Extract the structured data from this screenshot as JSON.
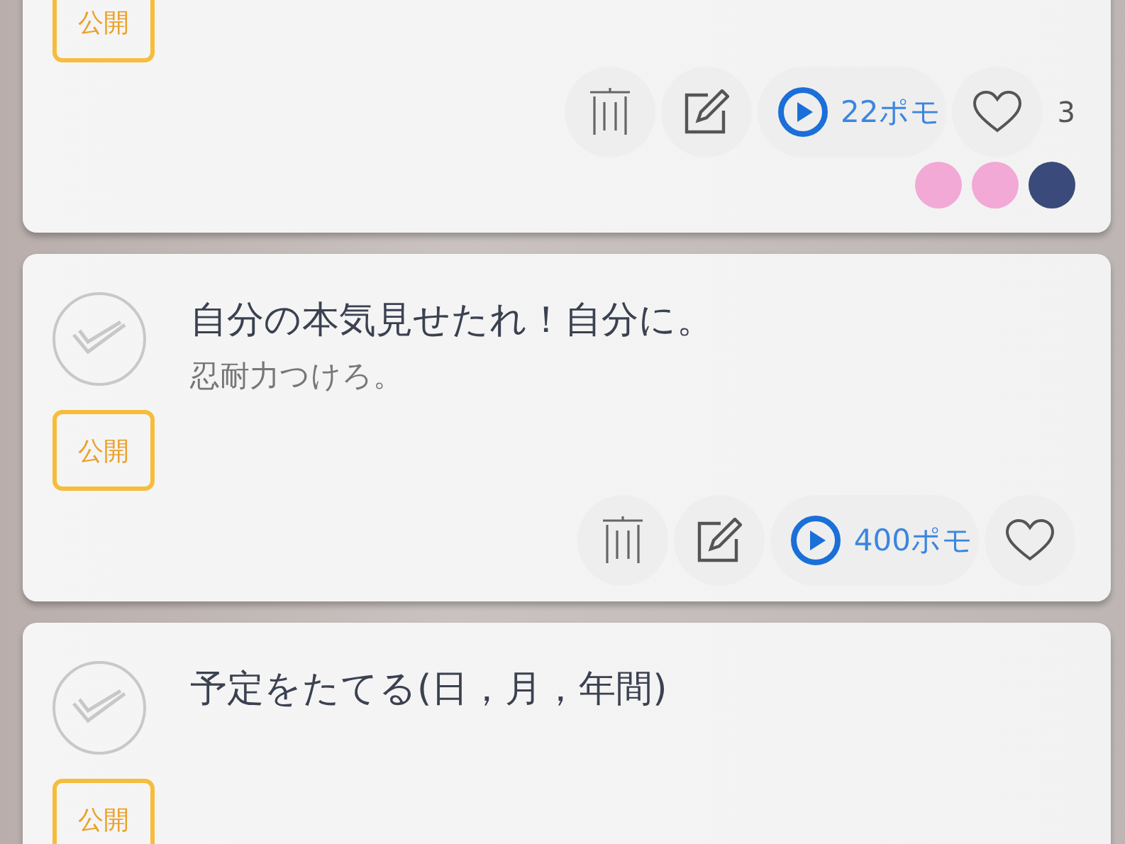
{
  "tasks": [
    {
      "badge": "公開",
      "points": "22ポモ",
      "likes": "3",
      "avatars": [
        {
          "color": "#f2a9d6"
        },
        {
          "color": "#f2a9d6"
        },
        {
          "color": "#3a4a7a"
        }
      ]
    },
    {
      "checked": false,
      "title": "自分の本気見せたれ！自分に。",
      "note": "忍耐力つけろ。",
      "badge": "公開",
      "points": "400ポモ"
    },
    {
      "checked": false,
      "title": "予定をたてる(日，月，年間)",
      "badge": "公開"
    }
  ]
}
